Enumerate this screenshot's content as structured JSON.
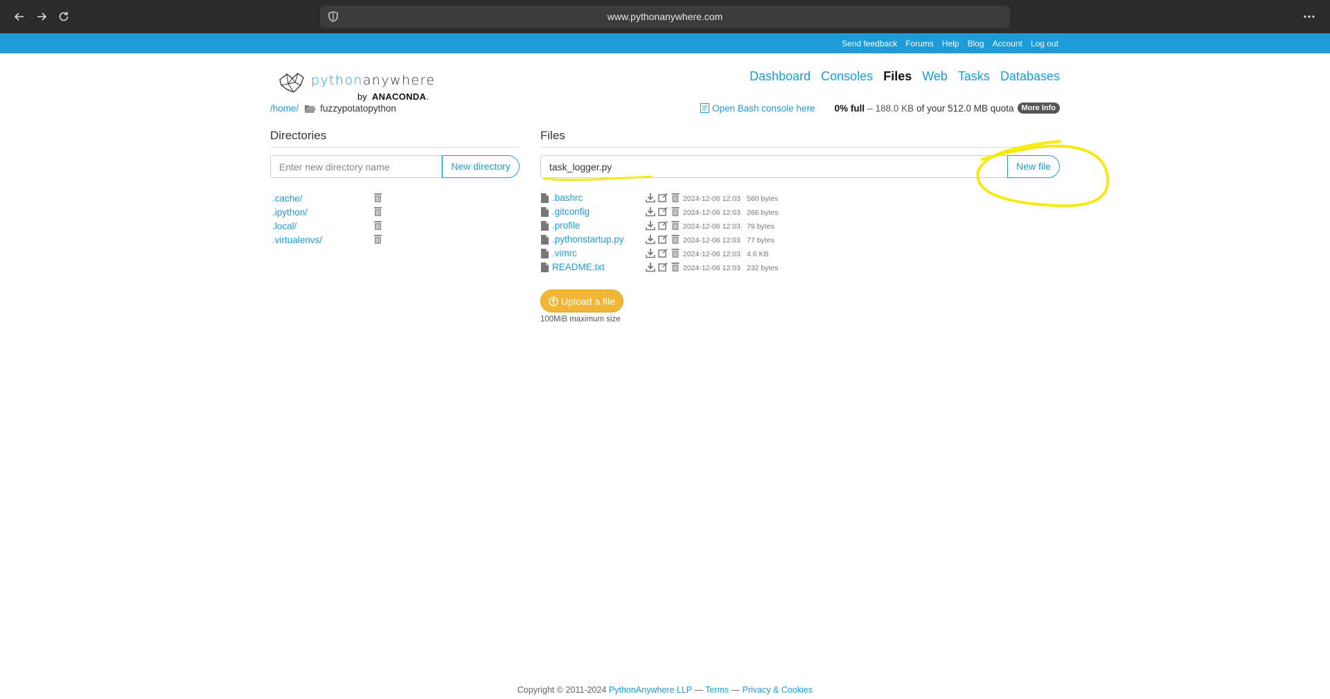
{
  "browser": {
    "url": "www.pythonanywhere.com",
    "icons": [
      "back-icon",
      "forward-icon",
      "reload-icon",
      "shield-icon",
      "more-menu-icon"
    ]
  },
  "topbar": {
    "links": [
      "Send feedback",
      "Forums",
      "Help",
      "Blog",
      "Account",
      "Log out"
    ]
  },
  "logo": {
    "python": "python",
    "anywhere": "anywhere",
    "by": "by",
    "anaconda": "ANACONDA",
    "anaconda_suffix": "."
  },
  "nav": {
    "items": [
      "Dashboard",
      "Consoles",
      "Files",
      "Web",
      "Tasks",
      "Databases"
    ],
    "active": "Files"
  },
  "breadcrumb": {
    "home": "/home/",
    "current": "fuzzypotatopython"
  },
  "quota": {
    "bash_link": "Open Bash console here",
    "full": "0% full",
    "dash": "–",
    "used": "188.0 KB",
    "of": "of your 512.0 MB quota",
    "more_info": "More Info"
  },
  "directories": {
    "title": "Directories",
    "placeholder": "Enter new directory name",
    "button": "New directory",
    "items": [
      ".cache/",
      ".ipython/",
      ".local/",
      ".virtualenvs/"
    ]
  },
  "files": {
    "title": "Files",
    "input_value": "task_logger.py",
    "button": "New file",
    "items": [
      {
        "name": ".bashrc",
        "date": "2024-12-06 12:03",
        "size": "560 bytes"
      },
      {
        "name": ".gitconfig",
        "date": "2024-12-06 12:03",
        "size": "266 bytes"
      },
      {
        "name": ".profile",
        "date": "2024-12-06 12:03",
        "size": "79 bytes"
      },
      {
        "name": ".pythonstartup.py",
        "date": "2024-12-06 12:03",
        "size": "77 bytes"
      },
      {
        "name": ".vimrc",
        "date": "2024-12-06 12:03",
        "size": "4.6 KB"
      },
      {
        "name": "README.txt",
        "date": "2024-12-06 12:03",
        "size": "232 bytes"
      }
    ],
    "upload_label": "Upload a file",
    "max_size": "100MiB maximum size"
  },
  "footer": {
    "copyright": "Copyright © 2011-2024",
    "company": "PythonAnywhere LLP",
    "sep1": "—",
    "terms": "Terms",
    "sep2": "—",
    "privacy": "Privacy & Cookies"
  },
  "colors": {
    "brand_blue": "#1d9bd7",
    "upload_yellow": "#f2b535",
    "annotation_yellow": "#f5ea12"
  }
}
